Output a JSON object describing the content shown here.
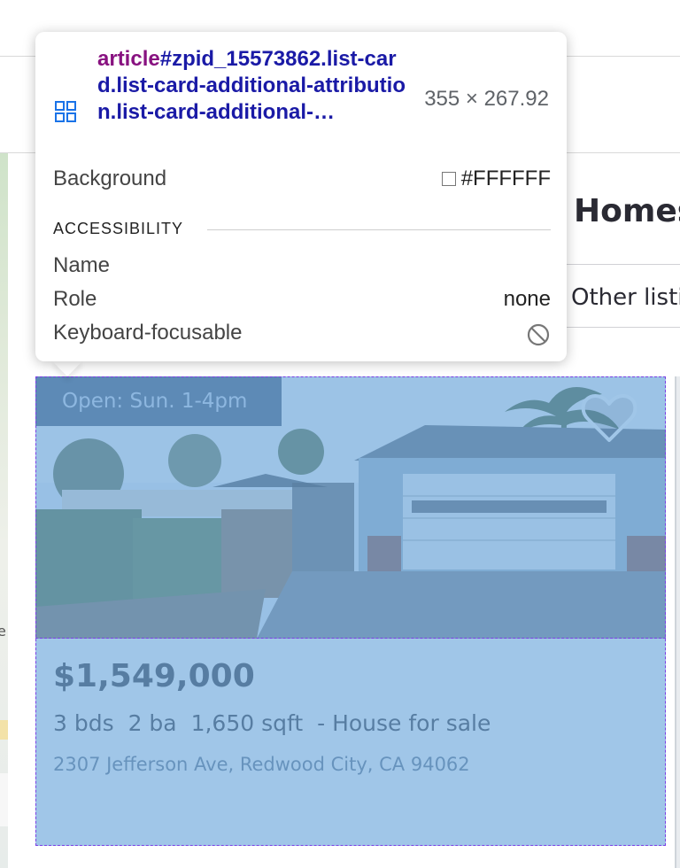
{
  "page": {
    "heading": "Homes",
    "filter_tab": "Other listi",
    "map_label": "e"
  },
  "listing": {
    "open_house": "Open: Sun. 1-4pm",
    "house_number": "2307",
    "price": "$1,549,000",
    "beds": "3 bds",
    "baths": "2 ba",
    "sqft": "1,650 sqft",
    "type": "- House for sale",
    "address": "2307 Jefferson Ave, Redwood City, CA 94062",
    "favorite_icon": "heart-icon"
  },
  "inspector": {
    "tag": "article",
    "selector": "#zpid_15573862.list-card.list-card-additional-attribution.list-card-additional-…",
    "dimensions": "355 × 267.92",
    "background_label": "Background",
    "background_value": "#FFFFFF",
    "section_title": "ACCESSIBILITY",
    "name_label": "Name",
    "role_label": "Role",
    "role_value": "none",
    "focusable_label": "Keyboard-focusable",
    "focusable_icon": "no-entry-icon",
    "node_icon": "grid-icon",
    "highlight_color": "#6fa8dc",
    "outline_color": "#7b3fe4"
  }
}
